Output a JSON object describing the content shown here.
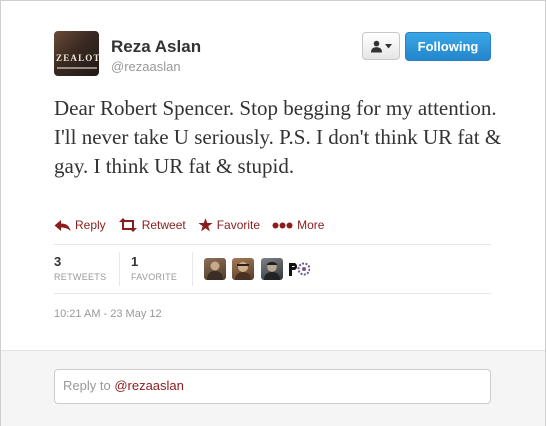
{
  "author": {
    "name": "Reza Aslan",
    "handle": "@rezaaslan",
    "avatar_text": "ZEALOT"
  },
  "buttons": {
    "follow_label": "Following",
    "user_menu_icon": "person-dropdown-icon"
  },
  "tweet": {
    "text": "Dear Robert Spencer. Stop begging for my attention. I'll never take U seriously. P.S. I don't think UR fat & gay. I think UR fat & stupid."
  },
  "actions": [
    {
      "label": "Reply",
      "icon": "reply-arrow-icon"
    },
    {
      "label": "Retweet",
      "icon": "retweet-icon"
    },
    {
      "label": "Favorite",
      "icon": "star-icon"
    },
    {
      "label": "More",
      "icon": "more-dots-icon"
    }
  ],
  "stats": {
    "retweets": {
      "count": "3",
      "label": "RETWEETS"
    },
    "favorites": {
      "count": "1",
      "label": "FAVORITE"
    }
  },
  "favoriters": [
    {
      "icon": "user-avatar-1",
      "color": "#6e5a44"
    },
    {
      "icon": "user-avatar-2",
      "color": "#7a5638"
    },
    {
      "icon": "user-avatar-3",
      "color": "#4a4e52"
    },
    {
      "icon": "user-avatar-4",
      "color": "#ffffff"
    }
  ],
  "timestamp": "10:21 AM - 23 May 12",
  "reply": {
    "prefix": "Reply to ",
    "mention": "@rezaaslan"
  },
  "colors": {
    "follow_blue": "#2b8fd6",
    "action_red": "#8b1d1d",
    "muted": "#999999"
  }
}
